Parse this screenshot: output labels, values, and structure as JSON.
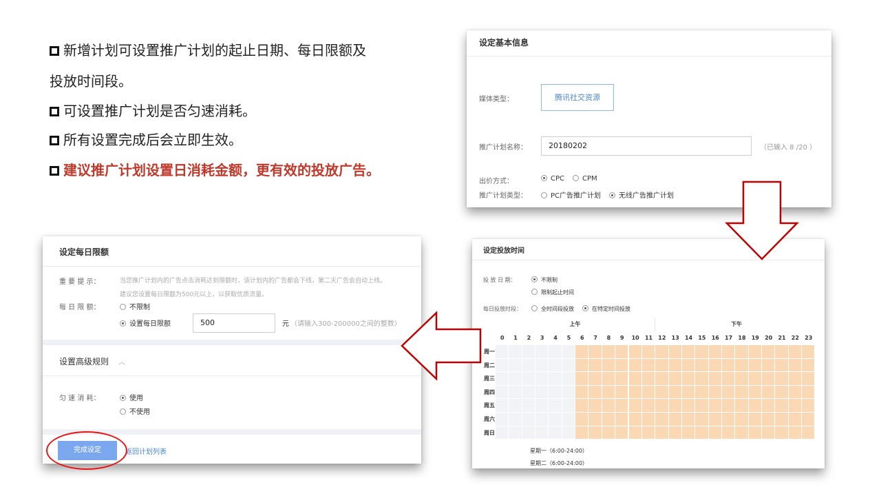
{
  "bullets": {
    "b1_line1": "新增计划可设置推广计划的起止日期、每日限额及",
    "b1_line2": "投放时间段。",
    "b2": "可设置推广计划是否匀速消耗。",
    "b3": "所有设置完成后会立即生效。",
    "b4": "建议推广计划设置日消耗金额，更有效的投放广告。"
  },
  "basic_info": {
    "title": "设定基本信息",
    "media_type_label": "媒体类型：",
    "media_type_value": "腾讯社交资源",
    "plan_name_label": "推广计划名称：",
    "plan_name_value": "20180202",
    "plan_name_count": "（已输入 8 /20 ）",
    "bid_label": "出价方式：",
    "bid_options": [
      "CPC",
      "CPM"
    ],
    "bid_selected": "CPC",
    "plan_type_label": "推广计划类型：",
    "plan_type_options": [
      "PC广告推广计划",
      "无线广告推广计划"
    ],
    "plan_type_selected": "无线广告推广计划"
  },
  "daily_limit": {
    "title": "设定每日限额",
    "tip_label": "重 要 提 示：",
    "tip_line1": "当您推广计划内的广告点击消耗达到限额时，该计划内的广告都会下线，第二天广告会自动上线。",
    "tip_line2": "建议您设置每日限额为500元以上，以获取优质流量。",
    "limit_label": "每 日 限 额：",
    "option_unlimited": "不限制",
    "option_set": "设置每日限额",
    "selected": "设置每日限额",
    "limit_value": "500",
    "unit": "元",
    "range_hint": "（请输入300-200000之间的整数）",
    "advanced_title": "设置高级规则",
    "pace_label": "匀 速 消 耗：",
    "pace_options": [
      "使用",
      "不使用"
    ],
    "pace_selected": "使用",
    "done_button": "完成设定",
    "back_link": "返回计划列表"
  },
  "schedule": {
    "title": "设定投放时间",
    "date_label": "投 放 日 期：",
    "date_options": [
      "不限制",
      "限制起止时间"
    ],
    "date_selected": "不限制",
    "period_label": "每日投放时段：",
    "period_options": [
      "全时间段投放",
      "在特定时间投放"
    ],
    "period_selected": "在特定时间投放",
    "am_label": "上午",
    "pm_label": "下午",
    "hours": [
      "0",
      "1",
      "2",
      "3",
      "4",
      "5",
      "6",
      "7",
      "8",
      "9",
      "10",
      "11",
      "12",
      "13",
      "14",
      "15",
      "16",
      "17",
      "18",
      "19",
      "20",
      "21",
      "22",
      "23"
    ],
    "days": [
      "周一",
      "周二",
      "周三",
      "周四",
      "周五",
      "周六",
      "周日"
    ],
    "active_from_hour": 6,
    "summary": [
      "星期一（6:00-24:00）",
      "星期二（6:00-24:00）"
    ]
  },
  "colors": {
    "highlight_red": "#c0392b",
    "arrow_red": "#c00000",
    "link_blue": "#4a86d4",
    "button_blue": "#7ba7ef",
    "active_cell": "#fbd8b4",
    "inactive_cell": "#f1f3f6"
  }
}
